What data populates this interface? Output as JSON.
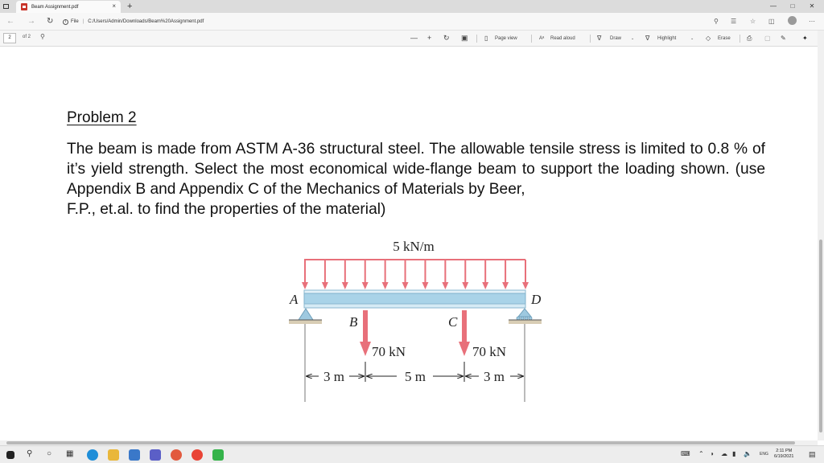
{
  "browser": {
    "tab_title": "Beam Assignment.pdf",
    "tab_close": "×",
    "new_tab": "+",
    "minimize": "—",
    "maximize": "□",
    "close": "✕",
    "url_scheme": "File",
    "url": "C:/Users/Admin/Downloads/Beam%20Assignment.pdf"
  },
  "pdf_toolbar": {
    "page_number": "2",
    "page_of": "of 2",
    "zoom_out": "—",
    "zoom_in": "+",
    "page_view": "Page view",
    "read_aloud": "Read aloud",
    "draw": "Draw",
    "highlight": "Highlight",
    "erase": "Erase"
  },
  "document": {
    "heading": "Problem 2",
    "paragraph": "The beam is made from ASTM A-36 structural steel. The allowable tensile stress is limited to 0.8 % of it’s yield strength. Select the most economical wide-flange beam to support the loading shown. (use Appendix B and Appendix C of the Mechanics of Materials by Beer,",
    "paragraph_last": "F.P., et.al. to find the properties of the material)",
    "figure": {
      "distributed_load": "5 kN/m",
      "label_a": "A",
      "label_b": "B",
      "label_c": "C",
      "label_d": "D",
      "load_b": "70 kN",
      "load_c": "70 kN",
      "dim_1": "3 m",
      "dim_2": "5 m",
      "dim_3": "3 m",
      "load_color": "#e8707a",
      "beam_color": "#a9d3e8"
    }
  },
  "taskbar": {
    "language": "ENG",
    "time": "2:11 PM",
    "date": "6/19/2021"
  }
}
